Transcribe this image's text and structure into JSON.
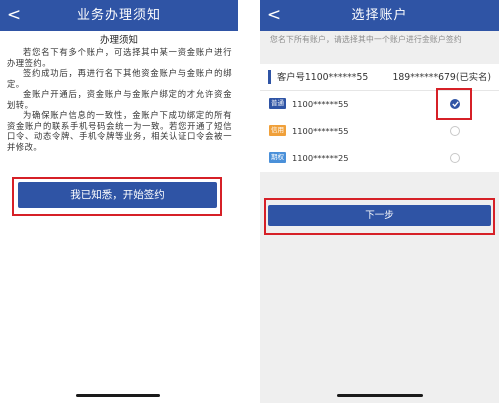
{
  "left_screen": {
    "header": {
      "back_icon": "chevron-left-icon",
      "back_glyph": "<",
      "title": "业务办理须知"
    },
    "notice": {
      "heading": "办理须知",
      "paragraphs": [
        "若您名下有多个账户，可选择其中某一资金账户进行办理签约。",
        "签约成功后，再进行名下其他资金账户与金账户的绑定。",
        "金账户开通后，资金账户与金账户绑定的才允许资金划转。",
        "为确保账户信息的一致性，金账户下成功绑定的所有资金账户的联系手机号码会统一为一致。若您开通了短信口令、动态令牌、手机令牌等业务，相关认证口令会被一并修改。"
      ]
    },
    "sign_button_label": "我已知悉，开始签约"
  },
  "right_screen": {
    "header": {
      "back_icon": "chevron-left-icon",
      "back_glyph": "<",
      "title": "选择账户"
    },
    "hint": "您名下所有账户，请选择其中一个账户进行金账户签约",
    "customer": {
      "label": "客户号1100******55",
      "phone": "189******679(已实名)"
    },
    "accounts": [
      {
        "badge": "普通",
        "badge_color": "#2f54a5",
        "number": "1100******55",
        "selected": true
      },
      {
        "badge": "信用",
        "badge_color": "#f0a03a",
        "number": "1100******55",
        "selected": false
      },
      {
        "badge": "期权",
        "badge_color": "#4a90d9",
        "number": "1100******25",
        "selected": false
      }
    ],
    "next_button_label": "下一步"
  },
  "colors": {
    "brand_blue": "#2f54a5",
    "highlight_red": "#d62027",
    "background_gray": "#efefef"
  }
}
